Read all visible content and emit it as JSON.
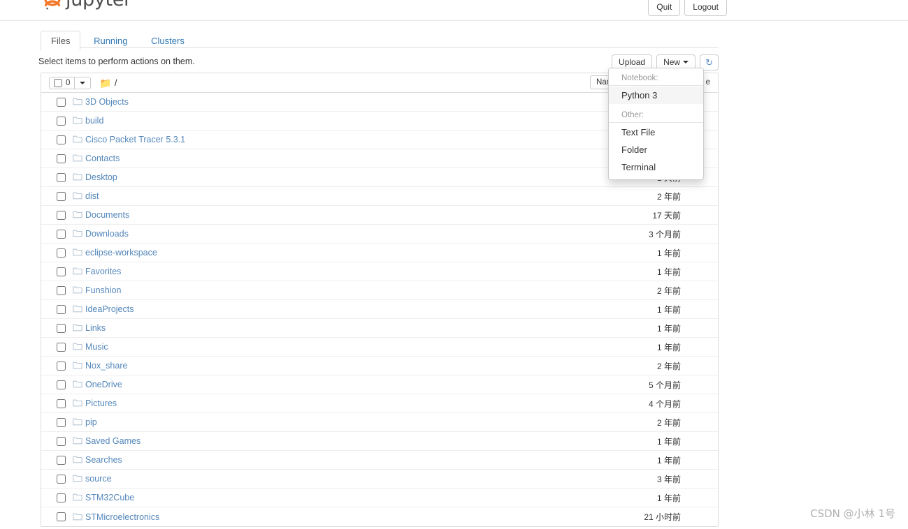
{
  "header": {
    "brand": "jupyter",
    "logo_icon": "jupyter-planet-logo",
    "quit_label": "Quit",
    "logout_label": "Logout"
  },
  "tabs": [
    {
      "label": "Files",
      "active": true
    },
    {
      "label": "Running",
      "active": false
    },
    {
      "label": "Clusters",
      "active": false
    }
  ],
  "toolbar": {
    "select_hint": "Select items to perform actions on them.",
    "upload_label": "Upload",
    "new_label": "New",
    "refresh_icon": "refresh-icon",
    "refresh_glyph": "↻"
  },
  "new_menu": {
    "notebook_header": "Notebook:",
    "notebook_items": [
      {
        "label": "Python 3",
        "hovered": true
      }
    ],
    "other_header": "Other:",
    "other_items": [
      {
        "label": "Text File",
        "hovered": false
      },
      {
        "label": "Folder",
        "hovered": false
      },
      {
        "label": "Terminal",
        "hovered": false
      }
    ]
  },
  "list_header": {
    "selected_count": "0",
    "select_caret_icon": "chevron-down-icon",
    "breadcrumb_icon": "folder-icon",
    "breadcrumb_path": "/",
    "name_sort_label": "Name",
    "name_sort_glyph": "↓",
    "modified_label": "e"
  },
  "files": [
    {
      "name": "3D Objects",
      "icon": "folder-icon",
      "modified": ""
    },
    {
      "name": "build",
      "icon": "folder-icon",
      "modified": ""
    },
    {
      "name": "Cisco Packet Tracer 5.3.1",
      "icon": "folder-icon",
      "modified": ""
    },
    {
      "name": "Contacts",
      "icon": "folder-icon",
      "modified": ""
    },
    {
      "name": "Desktop",
      "icon": "folder-icon",
      "modified": "1 天前"
    },
    {
      "name": "dist",
      "icon": "folder-icon",
      "modified": "2 年前"
    },
    {
      "name": "Documents",
      "icon": "folder-icon",
      "modified": "17 天前"
    },
    {
      "name": "Downloads",
      "icon": "folder-icon",
      "modified": "3 个月前"
    },
    {
      "name": "eclipse-workspace",
      "icon": "folder-icon",
      "modified": "1 年前"
    },
    {
      "name": "Favorites",
      "icon": "folder-icon",
      "modified": "1 年前"
    },
    {
      "name": "Funshion",
      "icon": "folder-icon",
      "modified": "2 年前"
    },
    {
      "name": "IdeaProjects",
      "icon": "folder-icon",
      "modified": "1 年前"
    },
    {
      "name": "Links",
      "icon": "folder-icon",
      "modified": "1 年前"
    },
    {
      "name": "Music",
      "icon": "folder-icon",
      "modified": "1 年前"
    },
    {
      "name": "Nox_share",
      "icon": "folder-icon",
      "modified": "2 年前"
    },
    {
      "name": "OneDrive",
      "icon": "folder-icon",
      "modified": "5 个月前"
    },
    {
      "name": "Pictures",
      "icon": "folder-icon",
      "modified": "4 个月前"
    },
    {
      "name": "pip",
      "icon": "folder-icon",
      "modified": "2 年前"
    },
    {
      "name": "Saved Games",
      "icon": "folder-icon",
      "modified": "1 年前"
    },
    {
      "name": "Searches",
      "icon": "folder-icon",
      "modified": "1 年前"
    },
    {
      "name": "source",
      "icon": "folder-icon",
      "modified": "3 年前"
    },
    {
      "name": "STM32Cube",
      "icon": "folder-icon",
      "modified": "1 年前"
    },
    {
      "name": "STMicroelectronics",
      "icon": "folder-icon",
      "modified": "21 小时前"
    }
  ],
  "watermark": "CSDN @小林 1号",
  "colors": {
    "link": "#5588bb",
    "tab_link": "#337ab7",
    "folder_blue": "#2c8ed6",
    "folder_grey": "#b9c6d4",
    "border": "#dddddd"
  }
}
